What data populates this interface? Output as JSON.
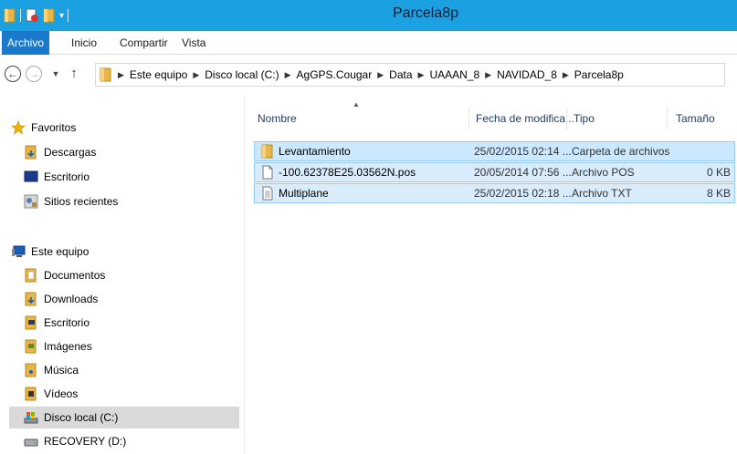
{
  "window": {
    "title": "Parcela8p"
  },
  "ribbon": {
    "tabs": [
      "Archivo",
      "Inicio",
      "Compartir",
      "Vista"
    ]
  },
  "address": {
    "crumbs": [
      "Este equipo",
      "Disco local (C:)",
      "AgGPS.Cougar",
      "Data",
      "UAAAN_8",
      "NAVIDAD_8",
      "Parcela8p"
    ]
  },
  "nav": {
    "favorites": {
      "label": "Favoritos",
      "items": [
        "Descargas",
        "Escritorio",
        "Sitios recientes"
      ]
    },
    "computer": {
      "label": "Este equipo",
      "items": [
        "Documentos",
        "Downloads",
        "Escritorio",
        "Imágenes",
        "Música",
        "Vídeos",
        "Disco local (C:)",
        "RECOVERY (D:)"
      ]
    }
  },
  "columns": {
    "name": "Nombre",
    "date": "Fecha de modifica...",
    "type": "Tipo",
    "size": "Tamaño"
  },
  "files": [
    {
      "name": "Levantamiento",
      "date": "25/02/2015 02:14 ...",
      "type": "Carpeta de archivos",
      "size": "",
      "icon": "folder-icon"
    },
    {
      "name": "-100.62378E25.03562N.pos",
      "date": "20/05/2014 07:56 ...",
      "type": "Archivo POS",
      "size": "0 KB",
      "icon": "file-icon"
    },
    {
      "name": "Multiplane",
      "date": "25/02/2015 02:18 ...",
      "type": "Archivo TXT",
      "size": "8 KB",
      "icon": "text-file-icon"
    }
  ],
  "colors": {
    "titlebar": "#1ba1e2",
    "file_tab": "#1979ca",
    "selection": "#cce8ff",
    "selection_border": "#99c9ef",
    "folder": "#e8b647"
  }
}
